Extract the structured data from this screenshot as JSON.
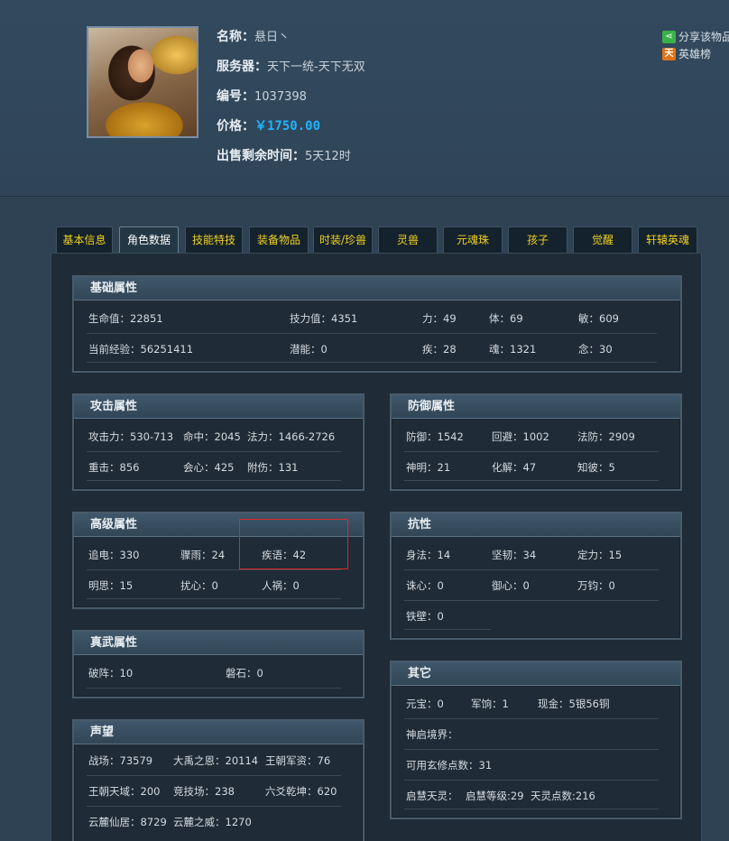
{
  "profile": {
    "name_label": "名称：",
    "name": "悬日丶",
    "server_label": "服务器：",
    "server": "天下一统-天下无双",
    "id_label": "编号：",
    "id": "1037398",
    "price_label": "价格：",
    "price": "￥1750.00",
    "time_label": "出售剩余时间：",
    "time": "5天12时"
  },
  "share": {
    "share_label": "分享该物品",
    "hero_label": "英雄榜",
    "hero_icon_text": "天"
  },
  "tabs": [
    "基本信息",
    "角色数据",
    "技能特技",
    "装备物品",
    "时装/珍兽",
    "灵兽",
    "元魂珠",
    "孩子",
    "觉醒",
    "轩辕英魂"
  ],
  "active_tab": 1,
  "panels": {
    "basic": {
      "title": "基础属性",
      "r1": [
        "生命值：22851",
        "技力值：4351",
        "力：49",
        "体：69",
        "敏：609"
      ],
      "r2": [
        "当前经验：56251411",
        "潜能：0",
        "疾：28",
        "魂：1321",
        "念：30"
      ]
    },
    "attack": {
      "title": "攻击属性",
      "r1": [
        "攻击力：530-713",
        "命中：2045",
        "法力：1466-2726"
      ],
      "r2": [
        "重击：856",
        "会心：425",
        "附伤：131"
      ]
    },
    "defense": {
      "title": "防御属性",
      "r1": [
        "防御：1542",
        "回避：1002",
        "法防：2909"
      ],
      "r2": [
        "神明：21",
        "化解：47",
        "知彼：5"
      ]
    },
    "advanced": {
      "title": "高级属性",
      "r1": [
        "追电：330",
        "骤雨：24",
        "疾语：42"
      ],
      "r2": [
        "明思：15",
        "扰心：0",
        "人祸：0"
      ]
    },
    "resist": {
      "title": "抗性",
      "r1": [
        "身法：14",
        "坚韧：34",
        "定力：15"
      ],
      "r2": [
        "诛心：0",
        "御心：0",
        "万钧：0"
      ],
      "r3": [
        "铁壁：0"
      ]
    },
    "martial": {
      "title": "真武属性",
      "r1": [
        "破阵：10",
        "磐石：0"
      ]
    },
    "other": {
      "title": "其它",
      "r1": [
        "元宝：0",
        "军饷：1",
        "现金：5银56铜"
      ],
      "r2": "神启境界：",
      "r3": "可用玄修点数：31",
      "r4": [
        "启慧天灵：",
        "启慧等级:29",
        "天灵点数:216"
      ]
    },
    "fame": {
      "title": "声望",
      "r1": [
        "战场：73579",
        "大禹之恩：20114",
        "王朝军资：76"
      ],
      "r2": [
        "王朝天域：200",
        "竞技场：238",
        "六爻乾坤：620"
      ],
      "r3": [
        "云麓仙居：8729",
        "云麓之威：1270"
      ]
    }
  },
  "colors": {
    "price": "#22b3ff",
    "tab_text": "#f0d020",
    "highlight_box": "#e0262b"
  }
}
